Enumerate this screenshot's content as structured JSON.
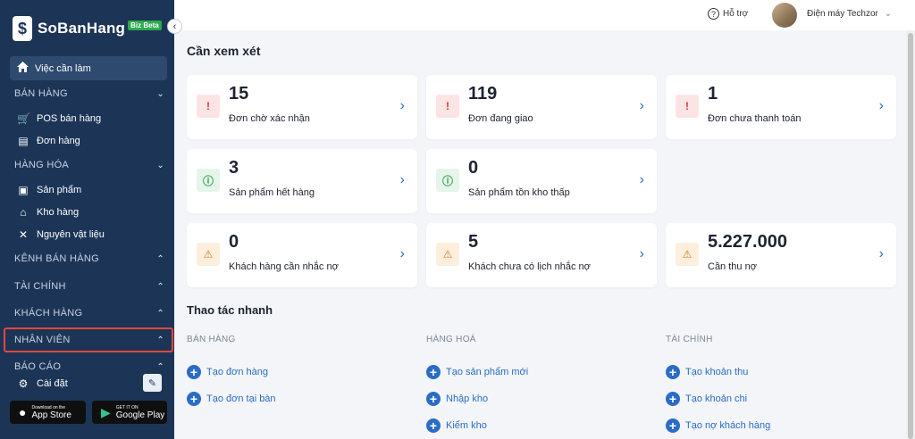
{
  "sidebar": {
    "brand": "SoBanHang",
    "brand_badge": "Biz Beta",
    "active_item": "Việc cần làm",
    "sections": {
      "ban_hang": "BÁN HÀNG",
      "hang_hoa": "HÀNG HÓA",
      "kenh_ban_hang": "KÊNH BÁN HÀNG",
      "tai_chinh": "TÀI CHÍNH",
      "khach_hang": "KHÁCH HÀNG",
      "nhan_vien": "NHÂN VIÊN",
      "bao_cao": "BÁO CÁO"
    },
    "items": {
      "pos": "POS bán hàng",
      "don_hang": "Đơn hàng",
      "san_pham": "Sản phẩm",
      "kho_hang": "Kho hàng",
      "nguyen_vat_lieu": "Nguyên vật liệu",
      "cai_dat": "Cài đặt"
    },
    "app_store": {
      "small": "Download on the",
      "big": "App Store"
    },
    "google_play": {
      "small": "GET IT ON",
      "big": "Google Play"
    }
  },
  "topbar": {
    "help": "Hỗ trợ",
    "user": "Điện máy Techzor"
  },
  "main": {
    "title": "Cần xem xét",
    "cards": [
      {
        "value": "15",
        "label": "Đơn chờ xác nhận"
      },
      {
        "value": "119",
        "label": "Đơn đang giao"
      },
      {
        "value": "1",
        "label": "Đơn chưa thanh toán"
      },
      {
        "value": "3",
        "label": "Sản phẩm hết hàng"
      },
      {
        "value": "0",
        "label": "Sản phẩm tồn kho thấp"
      },
      {
        "value": "0",
        "label": "Khách hàng cần nhắc nợ"
      },
      {
        "value": "5",
        "label": "Khách chưa có lịch nhắc nợ"
      },
      {
        "value": "5.227.000",
        "label": "Cần thu nợ"
      }
    ],
    "quick_title": "Thao tác nhanh",
    "quick_columns": [
      {
        "heading": "BÁN HÀNG",
        "actions": [
          "Tạo đơn hàng",
          "Tạo đơn tại bàn"
        ]
      },
      {
        "heading": "HÀNG HOÁ",
        "actions": [
          "Tạo sản phẩm mới",
          "Nhập kho",
          "Kiểm kho"
        ]
      },
      {
        "heading": "TÀI CHÍNH",
        "actions": [
          "Tạo khoản thu",
          "Tạo khoản chi",
          "Tạo nợ khách hàng"
        ]
      }
    ]
  },
  "colors": {
    "sidebar_bg": "#1c3557",
    "accent": "#2b6cc4",
    "alert_red": "#d63a3a",
    "ok_green": "#2c9c4b",
    "warn_orange": "#d57a18",
    "highlight_border": "#e0473f"
  }
}
